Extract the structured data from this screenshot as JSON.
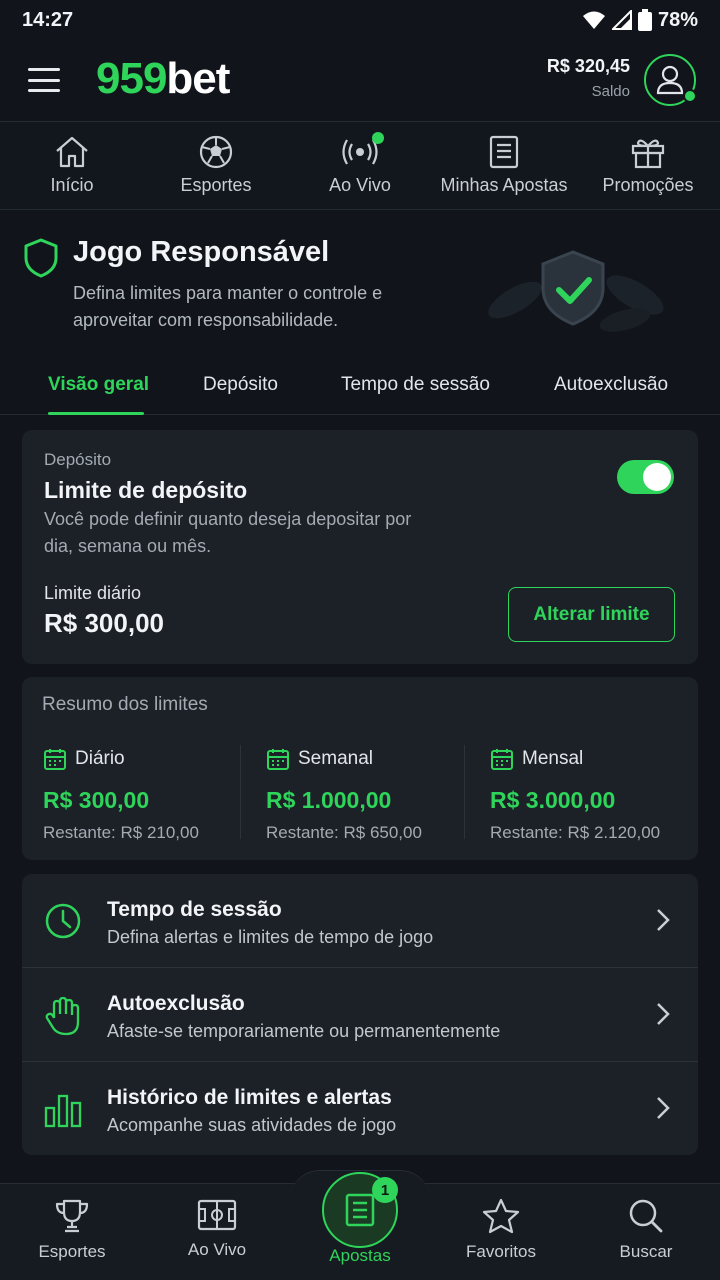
{
  "status_bar": {
    "time": "14:27",
    "battery": "78%"
  },
  "header": {
    "logo_num": "959",
    "logo_txt": "bet",
    "balance": "R$ 320,45",
    "balance_label": "Saldo"
  },
  "top_nav": [
    {
      "label": "Início",
      "icon": "home-icon"
    },
    {
      "label": "Esportes",
      "icon": "soccer-ball-icon"
    },
    {
      "label": "Ao Vivo",
      "icon": "live-broadcast-icon"
    },
    {
      "label": "Minhas Apostas",
      "icon": "bet-slip-icon"
    },
    {
      "label": "Promoções",
      "icon": "gift-icon"
    }
  ],
  "hero": {
    "title": "Jogo Responsável",
    "subtitle": "Defina limites para manter o controle e aproveitar com responsabilidade."
  },
  "tabs": [
    "Visão geral",
    "Depósito",
    "Tempo de sessão",
    "Autoexclusão"
  ],
  "active_tab": "Visão geral",
  "deposit_card": {
    "kicker": "Depósito",
    "title": "Limite de depósito",
    "description": "Você pode definir quanto deseja depositar por dia, semana ou mês.",
    "toggle_on": true,
    "limit_label": "Limite diário",
    "limit_value": "R$ 300,00",
    "button": "Alterar limite"
  },
  "summary": {
    "heading": "Resumo dos limites",
    "columns": [
      {
        "label": "Diário",
        "value": "R$ 300,00",
        "remaining": "Restante: R$ 210,00"
      },
      {
        "label": "Semanal",
        "value": "R$ 1.000,00",
        "remaining": "Restante: R$ 650,00"
      },
      {
        "label": "Mensal",
        "value": "R$ 3.000,00",
        "remaining": "Restante: R$ 2.120,00"
      }
    ]
  },
  "options": [
    {
      "title": "Tempo de sessão",
      "subtitle": "Defina alertas e limites de tempo de jogo",
      "icon": "clock-icon"
    },
    {
      "title": "Autoexclusão",
      "subtitle": "Afaste-se temporariamente ou permanentemente",
      "icon": "hand-icon"
    },
    {
      "title": "Histórico de limites e alertas",
      "subtitle": "Acompanhe suas atividades de jogo",
      "icon": "bar-chart-icon"
    }
  ],
  "bottom_nav": [
    {
      "label": "Esportes",
      "icon": "trophy-icon"
    },
    {
      "label": "Ao Vivo",
      "icon": "field-icon"
    },
    {
      "label": "Apostas",
      "icon": "bet-slip-icon",
      "badge": "1"
    },
    {
      "label": "Favoritos",
      "icon": "star-icon"
    },
    {
      "label": "Buscar",
      "icon": "search-icon"
    }
  ],
  "colors": {
    "accent": "#2fd45a",
    "background": "#11151b",
    "card": "#1c2128"
  }
}
